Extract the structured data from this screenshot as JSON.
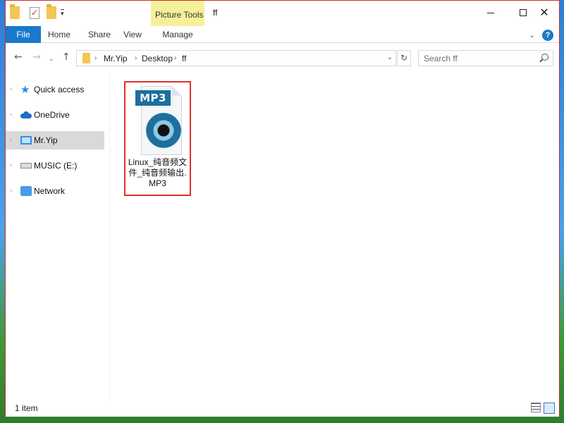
{
  "window": {
    "title": "ff"
  },
  "quick_access_toolbar": {
    "icons": [
      "folder-icon",
      "properties-check-icon",
      "new-folder-icon",
      "customize-dropdown-icon"
    ]
  },
  "ribbon": {
    "contextual_group": "Picture Tools",
    "tabs": [
      "File",
      "Home",
      "Share",
      "View",
      "Manage"
    ],
    "accent_color": "#1979ca",
    "contextual_color": "#f5f09a"
  },
  "address": {
    "breadcrumbs": [
      "Mr.Yip",
      "Desktop",
      "ff"
    ],
    "search_placeholder": "Search ff"
  },
  "navigation_pane": {
    "items": [
      {
        "label": "Quick access",
        "icon": "quick-access-star-icon"
      },
      {
        "label": "OneDrive",
        "icon": "onedrive-cloud-icon"
      },
      {
        "label": "Mr.Yip",
        "icon": "computer-icon",
        "selected": true
      },
      {
        "label": "MUSIC (E:)",
        "icon": "drive-icon"
      },
      {
        "label": "Network",
        "icon": "network-icon"
      }
    ]
  },
  "files": [
    {
      "name_line1": "Linux_纯音频文",
      "name_line2": "件_纯音频输出.",
      "name_line3": "MP3",
      "icon_badge": "MP3",
      "icon": "mp3-file-icon",
      "highlight_color": "#e0302a"
    }
  ],
  "status_bar": {
    "item_count": "1 item"
  }
}
